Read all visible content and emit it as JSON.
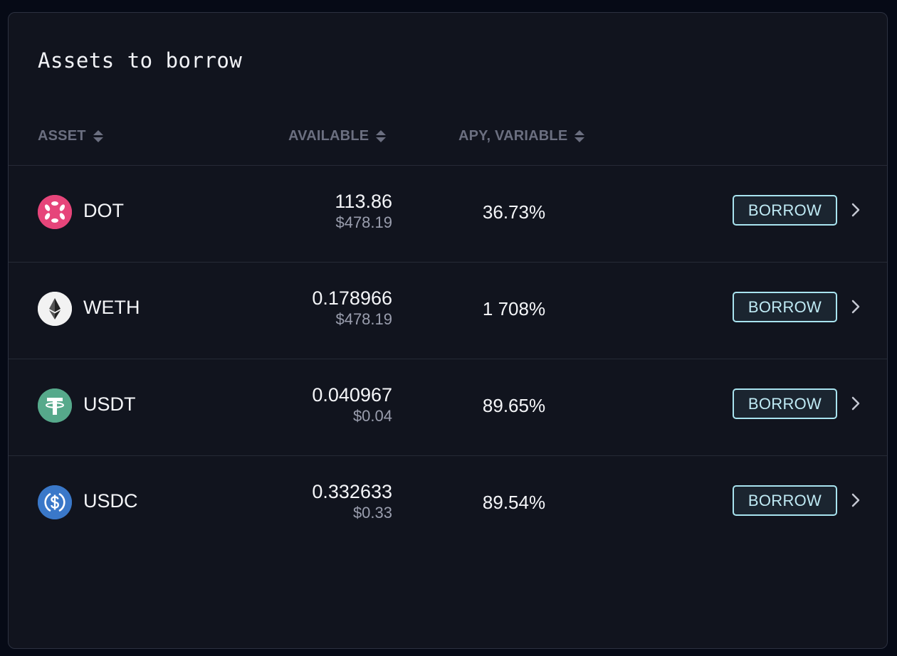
{
  "title": "Assets to borrow",
  "columns": {
    "asset": "ASSET",
    "available": "AVAILABLE",
    "apy": "APY, VARIABLE"
  },
  "rows": [
    {
      "symbol": "DOT",
      "icon": "polkadot-icon",
      "icon_color": "#e6007a",
      "amount": "113.86",
      "usd": "$478.19",
      "apy": "36.73%",
      "action": "BORROW"
    },
    {
      "symbol": "WETH",
      "icon": "ethereum-icon",
      "icon_color": "#f2f2f2",
      "amount": "0.178966",
      "usd": "$478.19",
      "apy": "1 708%",
      "action": "BORROW"
    },
    {
      "symbol": "USDT",
      "icon": "tether-icon",
      "icon_color": "#56a98b",
      "amount": "0.040967",
      "usd": "$0.04",
      "apy": "89.65%",
      "action": "BORROW"
    },
    {
      "symbol": "USDC",
      "icon": "usdc-icon",
      "icon_color": "#2f72c7",
      "amount": "0.332633",
      "usd": "$0.33",
      "apy": "89.54%",
      "action": "BORROW"
    }
  ]
}
